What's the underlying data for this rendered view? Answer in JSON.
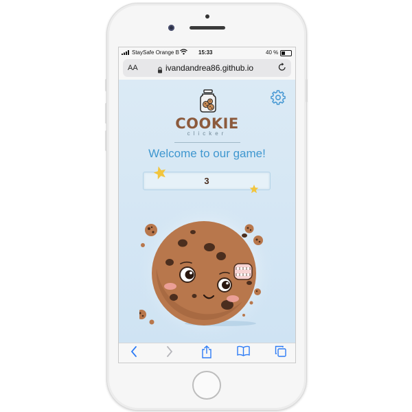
{
  "status_bar": {
    "carrier": "StaySafe Orange B",
    "time": "15:33",
    "battery": "40 %"
  },
  "browser": {
    "text_size_label": "AA",
    "url": "ivandandrea86.github.io"
  },
  "game": {
    "logo_title": "COOKIE",
    "logo_subtitle": "clicker",
    "welcome": "Welcome to our game!",
    "score": "3"
  },
  "icons": {
    "settings": "gear-icon",
    "jar": "cookie-jar-icon",
    "back": "chevron-left-icon",
    "forward": "chevron-right-icon",
    "share": "share-icon",
    "bookmarks": "book-icon",
    "tabs": "tabs-icon"
  },
  "colors": {
    "accent": "#3f97cf",
    "logo_brown": "#8c5a3c",
    "ios_blue": "#2d7cf6",
    "background_blue": "#d6e7f4"
  }
}
